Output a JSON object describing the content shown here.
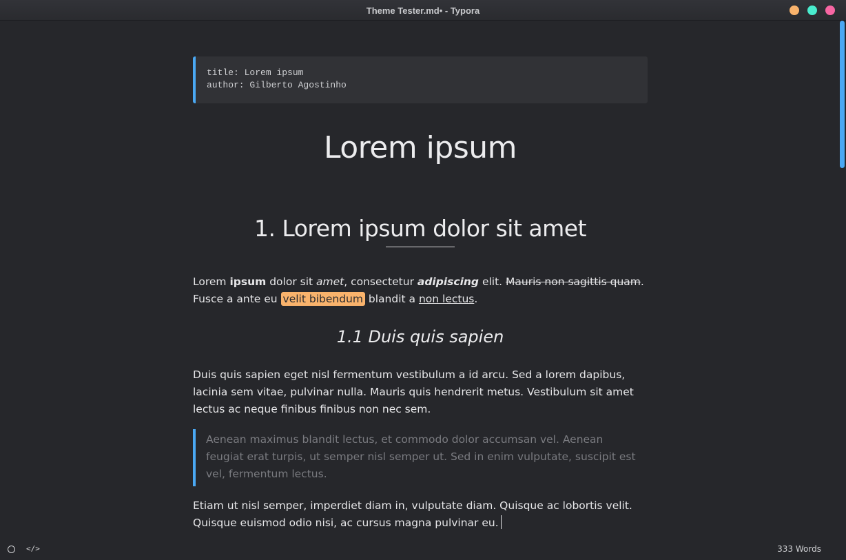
{
  "window": {
    "title": "Theme Tester.md• - Typora",
    "controls": {
      "minimize_color": "#f9b36c",
      "maximize_color": "#49ecce",
      "close_color": "#f866a3"
    }
  },
  "accent_color": "#4aa8f3",
  "frontmatter": {
    "lines": [
      "title: Lorem ipsum",
      "author: Gilberto Agostinho"
    ]
  },
  "document": {
    "h1": "Lorem ipsum",
    "h2": "1. Lorem ipsum dolor sit amet",
    "paragraph1": {
      "t1": "Lorem ",
      "bold": "ipsum",
      "t2": " dolor sit ",
      "italic": "amet",
      "t3": ", consectetur ",
      "bold_italic": "adipiscing",
      "t4": " elit. ",
      "strikethrough": "Mauris non sagittis quam",
      "t5": ". Fusce a ante eu ",
      "highlight": "velit bibendum",
      "t6": " blandit a ",
      "underline": "non lectus",
      "t7": "."
    },
    "h3": "1.1 Duis quis sapien",
    "paragraph2": "Duis quis sapien eget nisl fermentum vestibulum a id arcu. Sed a lorem dapibus, lacinia sem vitae, pulvinar nulla. Mauris quis hendrerit metus. Vestibulum sit amet lectus ac neque finibus finibus non nec sem.",
    "blockquote": "Aenean maximus blandit lectus, et commodo dolor accumsan vel. Aenean  feugiat erat turpis, ut semper nisl semper ut. Sed in enim vulputate,  suscipit est vel, fermentum lectus.",
    "paragraph3": "Etiam ut nisl semper, imperdiet diam in, vulputate diam. Quisque ac  lobortis velit. Quisque euismod odio nisi, ac cursus magna pulvinar eu."
  },
  "statusbar": {
    "outline_icon": "circle-outline-icon",
    "source_icon": "code-icon",
    "source_label": "</>",
    "word_count": "333 Words"
  }
}
